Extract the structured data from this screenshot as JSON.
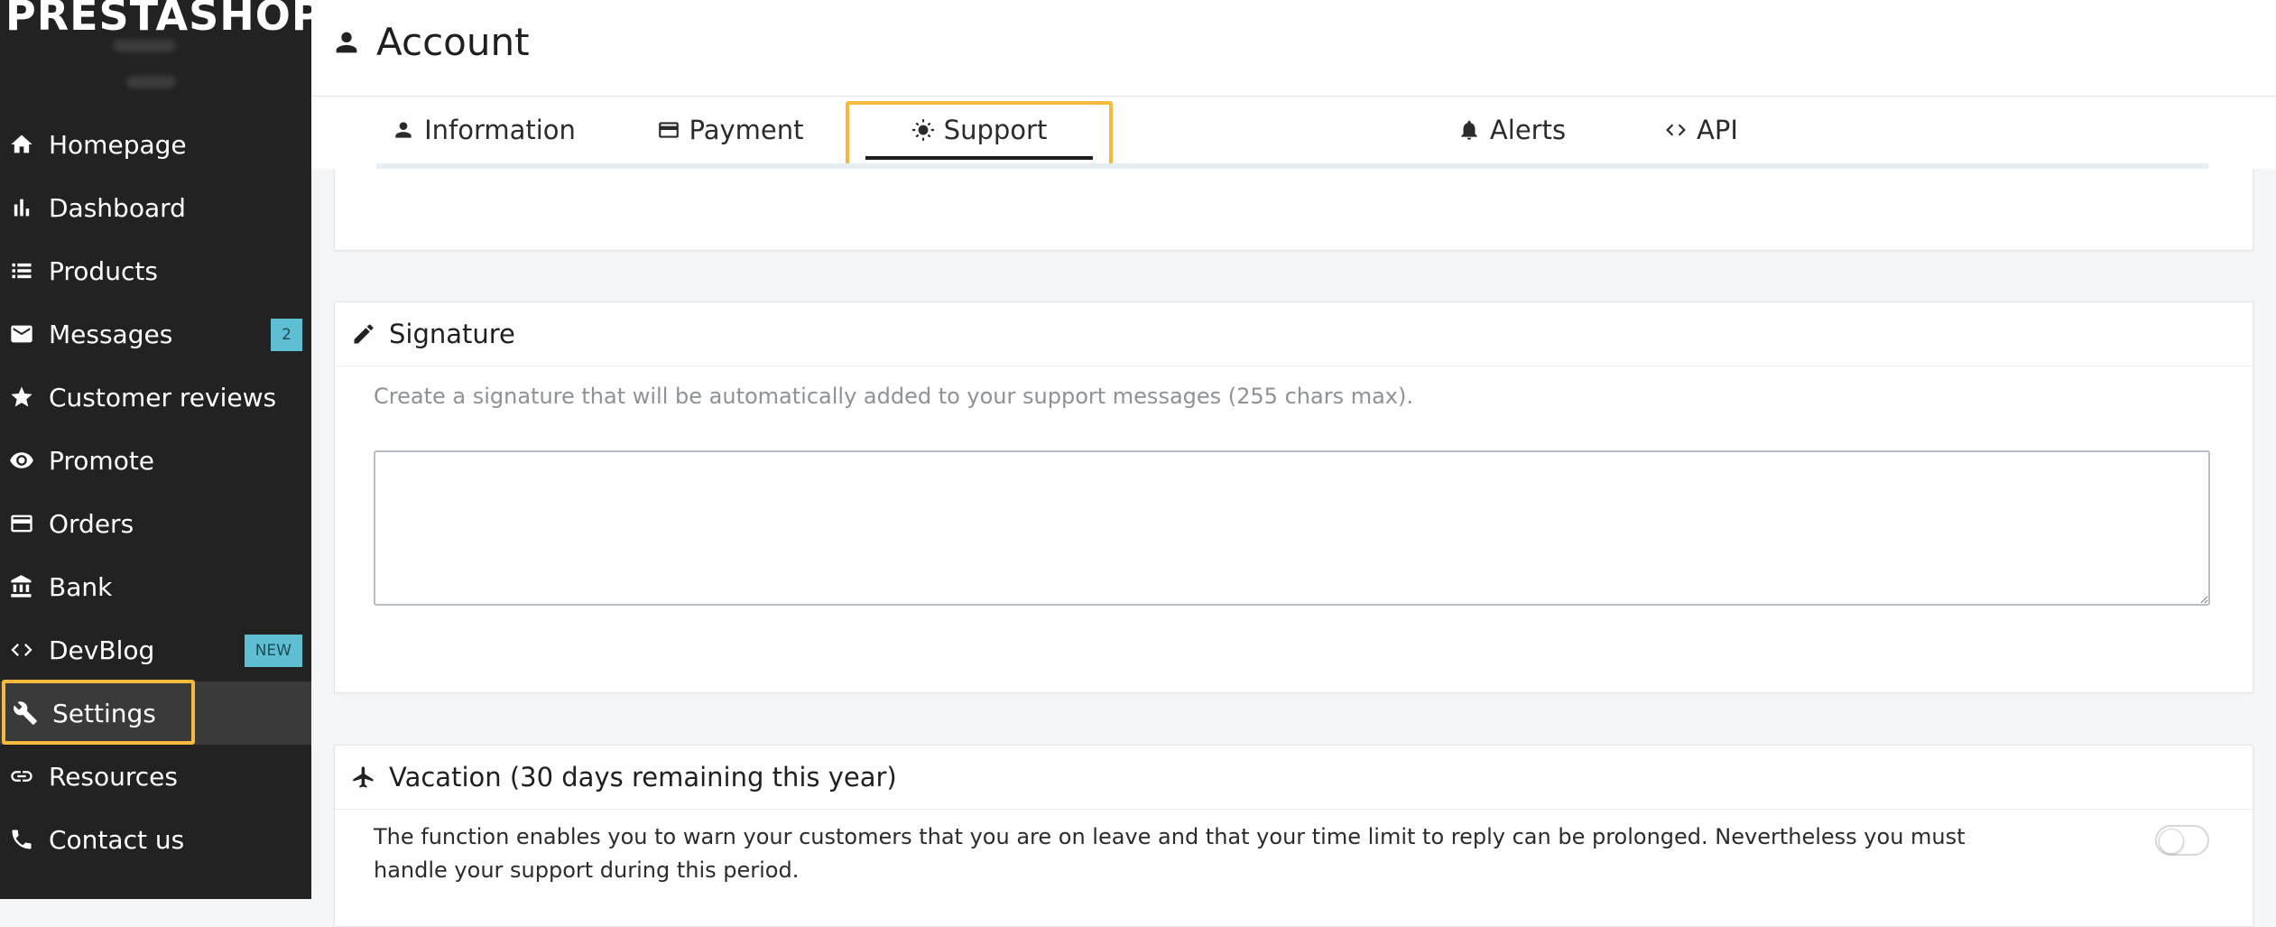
{
  "brand": {
    "logo_text": "PRESTASHOP"
  },
  "sidebar": {
    "items": [
      {
        "label": "Homepage",
        "icon": "home-icon"
      },
      {
        "label": "Dashboard",
        "icon": "bar-chart-icon"
      },
      {
        "label": "Products",
        "icon": "list-icon"
      },
      {
        "label": "Messages",
        "icon": "mail-icon",
        "badge": "2"
      },
      {
        "label": "Customer reviews",
        "icon": "star-icon"
      },
      {
        "label": "Promote",
        "icon": "eye-icon"
      },
      {
        "label": "Orders",
        "icon": "credit-card-icon"
      },
      {
        "label": "Bank",
        "icon": "bank-icon"
      },
      {
        "label": "DevBlog",
        "icon": "code-icon",
        "badge": "NEW"
      },
      {
        "label": "Settings",
        "icon": "wrench-icon",
        "active": true
      },
      {
        "label": "Resources",
        "icon": "link-icon"
      },
      {
        "label": "Contact us",
        "icon": "phone-icon"
      }
    ]
  },
  "header": {
    "title": "Account"
  },
  "tabs": [
    {
      "label": "Information",
      "icon": "user-icon"
    },
    {
      "label": "Payment",
      "icon": "credit-card-icon"
    },
    {
      "label": "Support",
      "icon": "sun-icon",
      "active": true
    },
    {
      "label": "Alerts",
      "icon": "bell-icon"
    },
    {
      "label": "API",
      "icon": "code-icon"
    }
  ],
  "signature": {
    "title": "Signature",
    "help": "Create a signature that will be automatically added to your support messages (255 chars max).",
    "value": ""
  },
  "vacation": {
    "title": "Vacation (30 days remaining this year)",
    "description": "The function enables you to warn your customers that you are on leave and that your time limit to reply can be prolonged. Nevertheless you must handle your support during this period.",
    "enabled": false
  },
  "colors": {
    "sidebar_bg": "#222222",
    "highlight": "#f5b93b",
    "badge_bg": "#5ebed2"
  }
}
